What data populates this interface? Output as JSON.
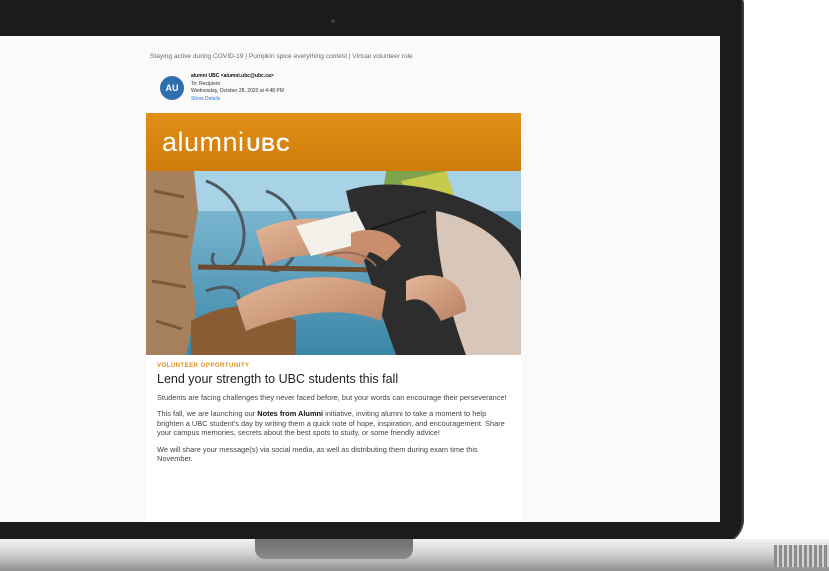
{
  "email": {
    "subject_line": "Staying active during COVID-19 | Pumpkin spice everything contest | Virtual volunteer role",
    "avatar_initials": "AU",
    "sender_from": "alumni UBC <alumni.ubc@ubc.ca>",
    "sender_to": "To: Recipient",
    "sender_date": "Wednesday, October 28, 2020 at 4:48 PM",
    "show_details": "Show Details",
    "banner": {
      "word1": "alumni",
      "word2": "UBC",
      "color": "#e08f16"
    },
    "eyebrow": "VOLUNTEER OPPORTUNITY",
    "headline": "Lend your strength to UBC students this fall",
    "para1": "Students are facing challenges they never faced before, but your words can encourage their perseverance!",
    "para2_prefix": "This fall, we are launching our ",
    "para2_bold": "Notes from Alumni",
    "para2_suffix": " initiative, inviting alumni to take a moment to help brighten a UBC student's day by writing them a quick note of hope, inspiration, and encouragement. Share your campus memories, secrets about the best spots to study, or some friendly advice!",
    "para3": "We will share your message(s) via social media, as well as distributing them during exam time this November."
  }
}
